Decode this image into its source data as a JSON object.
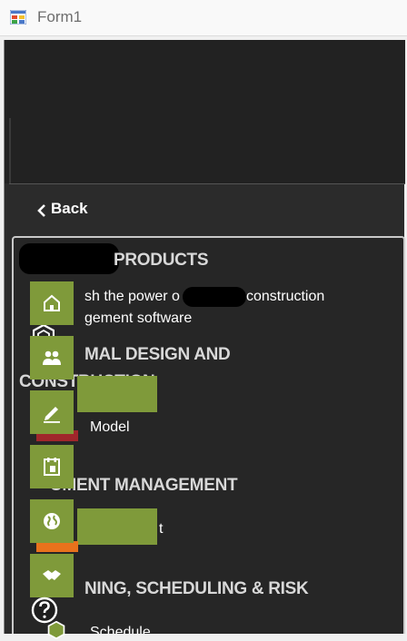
{
  "window": {
    "title": "Form1"
  },
  "nav": {
    "back_label": "Back"
  },
  "sections": {
    "products_heading": "PRODUCTS",
    "products_body_1a": "sh the power o",
    "products_body_1b": "construction",
    "products_body_2": "gement software",
    "formal_heading_1": "MAL DESIGN AND",
    "formal_heading_2": "CONSTRUCTION",
    "model_label": "Model",
    "doc_heading": "UMENT MANAGEMENT",
    "doc_item_tail": "t",
    "planning_heading": "NING, SCHEDULING & RISK",
    "schedule_label": "Schedule"
  },
  "icons": [
    "home-icon",
    "users-icon",
    "edit-icon",
    "calendar-icon",
    "globe-icon",
    "handshake-icon",
    "help-icon"
  ],
  "colors": {
    "rail_green": "#7f9a3a",
    "accent_red": "#a0262b",
    "accent_orange": "#e8721c"
  }
}
